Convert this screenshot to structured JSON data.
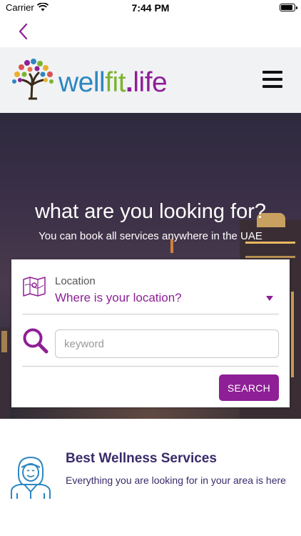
{
  "status_bar": {
    "carrier": "Carrier",
    "time": "7:44 PM"
  },
  "nav": {
    "back_icon": "chevron-left-icon"
  },
  "header": {
    "logo": {
      "well": "well",
      "fit": "fit",
      "dot": ".",
      "life": "life"
    },
    "menu_icon": "hamburger-menu-icon"
  },
  "hero": {
    "title": "what are you looking for?",
    "subtitle": "You can book all services anywhere in the UAE"
  },
  "search_form": {
    "location_label": "Location",
    "location_value": "Where is your location?",
    "keyword_placeholder": "keyword",
    "keyword_value": "",
    "search_button": "SEARCH"
  },
  "service": {
    "title": "Best Wellness Services",
    "description": "Everything you are looking for in your area is here"
  },
  "colors": {
    "brand_purple": "#8e1f96",
    "brand_blue": "#2e86c1",
    "brand_green": "#7bb32e",
    "heading_dark": "#3a2a6a"
  }
}
